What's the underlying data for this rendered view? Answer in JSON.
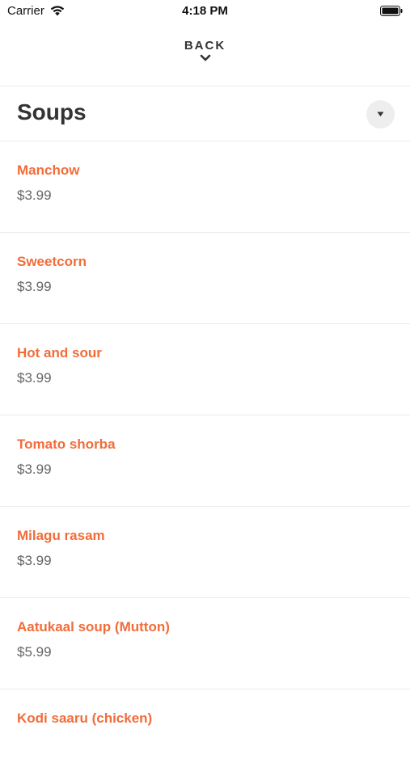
{
  "status_bar": {
    "carrier": "Carrier",
    "time": "4:18 PM",
    "wifi_icon": "wifi-icon",
    "battery_icon": "battery-icon"
  },
  "nav": {
    "back_label": "BACK",
    "back_icon": "chevron-down-icon"
  },
  "section": {
    "title": "Soups",
    "dropdown_icon": "caret-down-icon"
  },
  "colors": {
    "item_name": "#f26c3a",
    "price": "#666666",
    "divider": "#ebebeb"
  },
  "items": [
    {
      "name": "Manchow",
      "price": "$3.99"
    },
    {
      "name": "Sweetcorn",
      "price": "$3.99"
    },
    {
      "name": "Hot and sour",
      "price": "$3.99"
    },
    {
      "name": "Tomato shorba",
      "price": "$3.99"
    },
    {
      "name": "Milagu rasam",
      "price": "$3.99"
    },
    {
      "name": "Aatukaal soup (Mutton)",
      "price": "$5.99"
    },
    {
      "name": "Kodi saaru (chicken)",
      "price": ""
    }
  ]
}
